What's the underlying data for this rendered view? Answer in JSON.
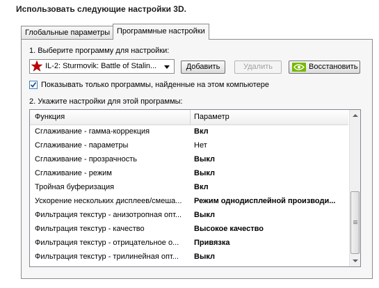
{
  "heading": "Использовать следующие настройки 3D.",
  "tabs": [
    {
      "label": "Глобальные параметры",
      "active": false
    },
    {
      "label": "Программные настройки",
      "active": true
    }
  ],
  "step1": {
    "label": "1. Выберите программу для настройки:",
    "program": {
      "value": "IL-2: Sturmovik: Battle of Stalin...",
      "icon": "red-star-icon"
    },
    "add_button": "Добавить",
    "remove_button": "Удалить",
    "restore_button": "Восстановить",
    "restore_icon": "nvidia-logo-icon"
  },
  "checkbox": {
    "label": "Показывать только программы, найденные на этом компьютере",
    "checked": true
  },
  "step2": {
    "label": "2. Укажите настройки для этой программы:",
    "columns": [
      "Функция",
      "Параметр"
    ],
    "rows": [
      {
        "feature": "Сглаживание - гамма-коррекция",
        "value": "Вкл",
        "bold": true
      },
      {
        "feature": "Сглаживание - параметры",
        "value": "Нет",
        "bold": false
      },
      {
        "feature": "Сглаживание - прозрачность",
        "value": "Выкл",
        "bold": true
      },
      {
        "feature": "Сглаживание - режим",
        "value": "Выкл",
        "bold": true
      },
      {
        "feature": "Тройная буферизация",
        "value": "Вкл",
        "bold": true
      },
      {
        "feature": "Ускорение нескольких дисплеев/смеша...",
        "value": "Режим однодисплейной производи...",
        "bold": true
      },
      {
        "feature": "Фильтрация текстур - анизотропная опт...",
        "value": "Выкл",
        "bold": true
      },
      {
        "feature": "Фильтрация текстур - качество",
        "value": "Высокое качество",
        "bold": true
      },
      {
        "feature": "Фильтрация текстур - отрицательное о...",
        "value": "Привязка",
        "bold": true
      },
      {
        "feature": "Фильтрация текстур - трилинейная опт...",
        "value": "Выкл",
        "bold": true
      }
    ]
  },
  "colors": {
    "accent": "#76b900",
    "star": "#cc0000",
    "check": "#1f4e9e"
  }
}
